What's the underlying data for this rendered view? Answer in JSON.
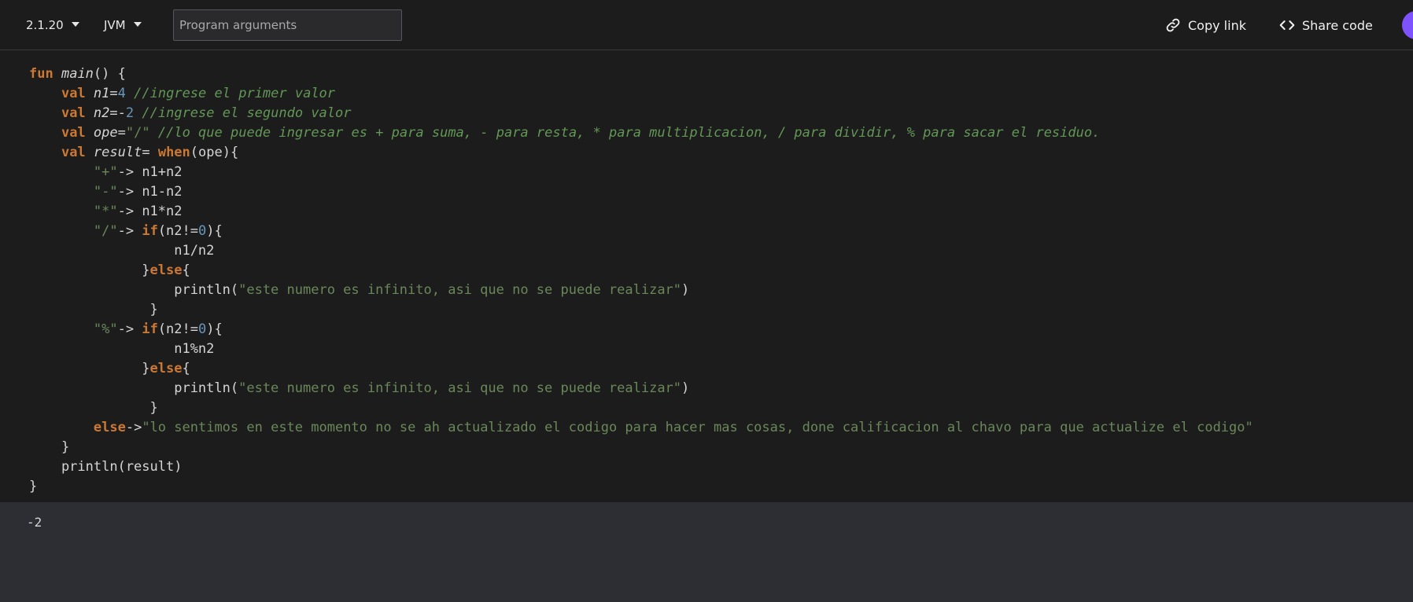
{
  "toolbar": {
    "version_label": "2.1.20",
    "platform_label": "JVM",
    "args_placeholder": "Program arguments",
    "args_value": "",
    "copy_link_label": "Copy link",
    "share_code_label": "Share code"
  },
  "code": {
    "lines": [
      [
        {
          "t": "fun",
          "c": "keyword"
        },
        {
          "t": " ",
          "c": "plain"
        },
        {
          "t": "main",
          "c": "func"
        },
        {
          "t": "() {",
          "c": "plain"
        }
      ],
      [
        {
          "t": "    ",
          "c": "plain"
        },
        {
          "t": "val",
          "c": "keyword"
        },
        {
          "t": " ",
          "c": "plain"
        },
        {
          "t": "n1",
          "c": "var"
        },
        {
          "t": "=",
          "c": "plain"
        },
        {
          "t": "4",
          "c": "number"
        },
        {
          "t": " ",
          "c": "plain"
        },
        {
          "t": "//ingrese el primer valor",
          "c": "comment"
        }
      ],
      [
        {
          "t": "    ",
          "c": "plain"
        },
        {
          "t": "val",
          "c": "keyword"
        },
        {
          "t": " ",
          "c": "plain"
        },
        {
          "t": "n2",
          "c": "var"
        },
        {
          "t": "=-",
          "c": "plain"
        },
        {
          "t": "2",
          "c": "number"
        },
        {
          "t": " ",
          "c": "plain"
        },
        {
          "t": "//ingrese el segundo valor",
          "c": "comment"
        }
      ],
      [
        {
          "t": "    ",
          "c": "plain"
        },
        {
          "t": "val",
          "c": "keyword"
        },
        {
          "t": " ",
          "c": "plain"
        },
        {
          "t": "ope",
          "c": "var"
        },
        {
          "t": "=",
          "c": "plain"
        },
        {
          "t": "\"/\"",
          "c": "string"
        },
        {
          "t": " ",
          "c": "plain"
        },
        {
          "t": "//lo que puede ingresar es + para suma, - para resta, * para multiplicacion, / para dividir, % para sacar el residuo.",
          "c": "comment"
        }
      ],
      [
        {
          "t": "    ",
          "c": "plain"
        },
        {
          "t": "val",
          "c": "keyword"
        },
        {
          "t": " ",
          "c": "plain"
        },
        {
          "t": "result",
          "c": "var"
        },
        {
          "t": "= ",
          "c": "plain"
        },
        {
          "t": "when",
          "c": "keyword"
        },
        {
          "t": "(ope){",
          "c": "plain"
        }
      ],
      [
        {
          "t": "        ",
          "c": "plain"
        },
        {
          "t": "\"+\"",
          "c": "string"
        },
        {
          "t": "-> n1+n2",
          "c": "plain"
        }
      ],
      [
        {
          "t": "        ",
          "c": "plain"
        },
        {
          "t": "\"-\"",
          "c": "string"
        },
        {
          "t": "-> n1-n2",
          "c": "plain"
        }
      ],
      [
        {
          "t": "        ",
          "c": "plain"
        },
        {
          "t": "\"*\"",
          "c": "string"
        },
        {
          "t": "-> n1*n2",
          "c": "plain"
        }
      ],
      [
        {
          "t": "        ",
          "c": "plain"
        },
        {
          "t": "\"/\"",
          "c": "string"
        },
        {
          "t": "-> ",
          "c": "plain"
        },
        {
          "t": "if",
          "c": "keyword"
        },
        {
          "t": "(n2!=",
          "c": "plain"
        },
        {
          "t": "0",
          "c": "number"
        },
        {
          "t": "){",
          "c": "plain"
        }
      ],
      [
        {
          "t": "                  n1/n2",
          "c": "plain"
        }
      ],
      [
        {
          "t": "              }",
          "c": "plain"
        },
        {
          "t": "else",
          "c": "keyword"
        },
        {
          "t": "{",
          "c": "plain"
        }
      ],
      [
        {
          "t": "                  println(",
          "c": "plain"
        },
        {
          "t": "\"este numero es infinito, asi que no se puede realizar\"",
          "c": "string"
        },
        {
          "t": ")",
          "c": "plain"
        }
      ],
      [
        {
          "t": "               }",
          "c": "plain"
        }
      ],
      [
        {
          "t": "        ",
          "c": "plain"
        },
        {
          "t": "\"%\"",
          "c": "string"
        },
        {
          "t": "-> ",
          "c": "plain"
        },
        {
          "t": "if",
          "c": "keyword"
        },
        {
          "t": "(n2!=",
          "c": "plain"
        },
        {
          "t": "0",
          "c": "number"
        },
        {
          "t": "){",
          "c": "plain"
        }
      ],
      [
        {
          "t": "                  n1%n2",
          "c": "plain"
        }
      ],
      [
        {
          "t": "              }",
          "c": "plain"
        },
        {
          "t": "else",
          "c": "keyword"
        },
        {
          "t": "{",
          "c": "plain"
        }
      ],
      [
        {
          "t": "                  println(",
          "c": "plain"
        },
        {
          "t": "\"este numero es infinito, asi que no se puede realizar\"",
          "c": "string"
        },
        {
          "t": ")",
          "c": "plain"
        }
      ],
      [
        {
          "t": "               }",
          "c": "plain"
        }
      ],
      [
        {
          "t": "        ",
          "c": "plain"
        },
        {
          "t": "else",
          "c": "keyword"
        },
        {
          "t": "->",
          "c": "plain"
        },
        {
          "t": "\"lo sentimos en este momento no se ah actualizado el codigo para hacer mas cosas, done calificacion al chavo para que actualize el codigo\"",
          "c": "string"
        }
      ],
      [
        {
          "t": "    }",
          "c": "plain"
        }
      ],
      [
        {
          "t": "    println(result)",
          "c": "plain"
        }
      ],
      [
        {
          "t": "}",
          "c": "plain"
        }
      ]
    ]
  },
  "output": {
    "text": "-2"
  },
  "colors": {
    "keyword": "#cc7832",
    "string": "#6a8759",
    "comment": "#629755",
    "number": "#6897bb",
    "accent": "#7f52ff"
  },
  "icons": {
    "version_caret": "chevron-down-icon",
    "platform_caret": "chevron-down-icon",
    "copy_link": "link-icon",
    "share_code": "code-icon"
  }
}
